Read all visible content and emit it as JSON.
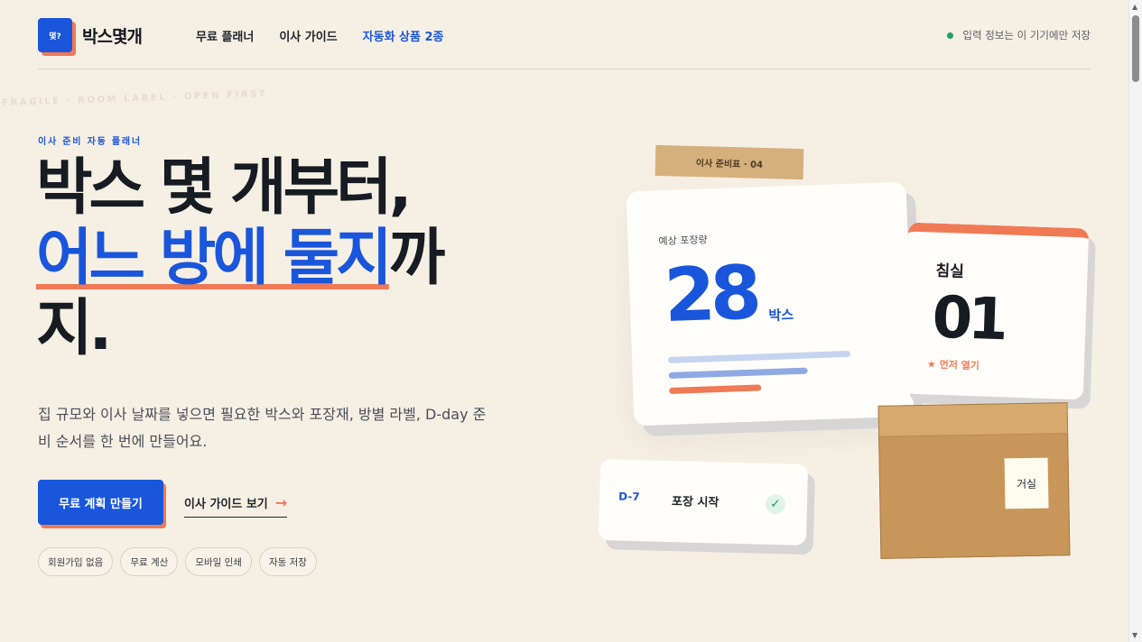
{
  "header": {
    "logo_mark": "몇?",
    "logo_text": "박스몇개",
    "nav": [
      {
        "label": "무료 플래너"
      },
      {
        "label": "이사 가이드"
      },
      {
        "label": "자동화 상품 2종"
      }
    ],
    "save_note": "입력 정보는 이 기기에만 저장"
  },
  "hero": {
    "watermark": "FRAGILE · ROOM LABEL · OPEN FIRST",
    "eyebrow": "이사 준비 자동 플래너",
    "headline_line1": "박스 몇 개부터,",
    "headline_blue": "어느 방에 둘지",
    "headline_rest": "까지.",
    "description": "집 규모와 이사 날짜를 넣으면 필요한 박스와 포장재, 방별 라벨, D-day 준비 순서를 한 번에 만들어요.",
    "cta_primary": "무료 계획 만들기",
    "cta_secondary": "이사 가이드 보기",
    "chips": [
      "회원가입 없음",
      "무료 계산",
      "모바일 인쇄",
      "자동 저장"
    ]
  },
  "illustration": {
    "tape": "이사 준비표 · 04",
    "estimate_label": "예상 포장량",
    "estimate_value": "28",
    "estimate_unit": "박스",
    "room_name": "침실",
    "room_number": "01",
    "open_first": "★ 먼저 열기",
    "box_label": "거실",
    "task_dday": "D-7",
    "task_label": "포장 시작",
    "icons": {
      "check": "check-icon",
      "arrow": "arrow-right-icon"
    },
    "colors": {
      "accent": "#1a56db",
      "orange": "#f07a55",
      "green": "#22a06b"
    }
  }
}
